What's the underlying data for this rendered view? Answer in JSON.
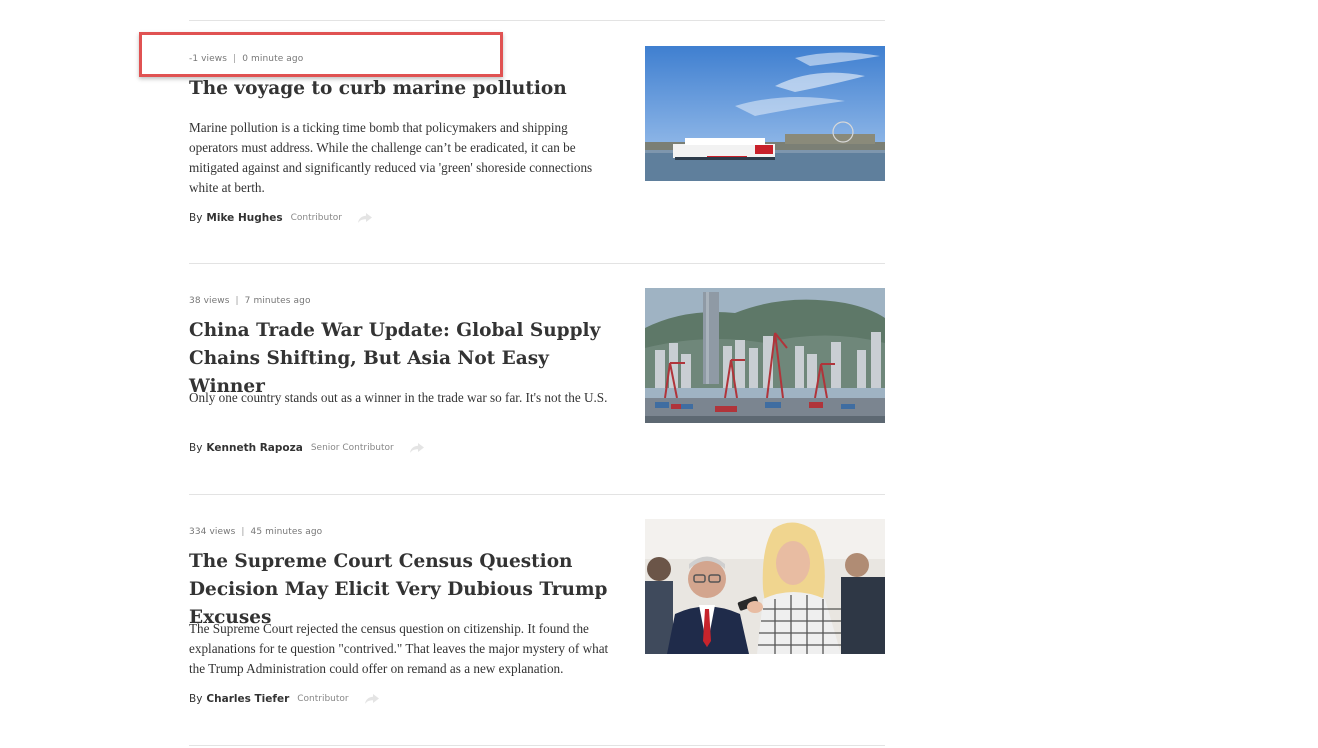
{
  "articles": [
    {
      "views": "-1 views",
      "time": "0 minute ago",
      "title": "The voyage to curb marine pollution",
      "description": "Marine pollution is a ticking time bomb that policymakers and shipping operators must address. While the challenge can’t be eradicated, it can be mitigated against and significantly reduced via 'green' shoreside connections white at berth.",
      "by": "By",
      "author": "Mike Hughes",
      "role": "Contributor",
      "image_icon": "cruise-ship-harbor-photo"
    },
    {
      "views": "38 views",
      "time": "7 minutes ago",
      "title": "China Trade War Update: Global Supply Chains Shifting, But Asia Not Easy Winner",
      "description": "Only one country stands out as a winner in the trade war so far. It's not the U.S.",
      "by": "By",
      "author": "Kenneth Rapoza",
      "role": "Senior Contributor",
      "image_icon": "container-port-city-photo"
    },
    {
      "views": "334 views",
      "time": "45 minutes ago",
      "title": "The Supreme Court Census Question Decision May Elicit Very Dubious Trump Excuses",
      "description": "The Supreme Court rejected the census question on citizenship. It found the explanations for te question \"contrived.\" That leaves the major mystery of what the Trump Administration could offer on remand as a new explanation.",
      "by": "By",
      "author": "Charles Tiefer",
      "role": "Contributor",
      "image_icon": "people-photo"
    }
  ],
  "meta_separator": "|",
  "colors": {
    "highlight": "#e05252",
    "divider": "#e3e3e3",
    "text": "#333333",
    "meta": "#777777"
  }
}
